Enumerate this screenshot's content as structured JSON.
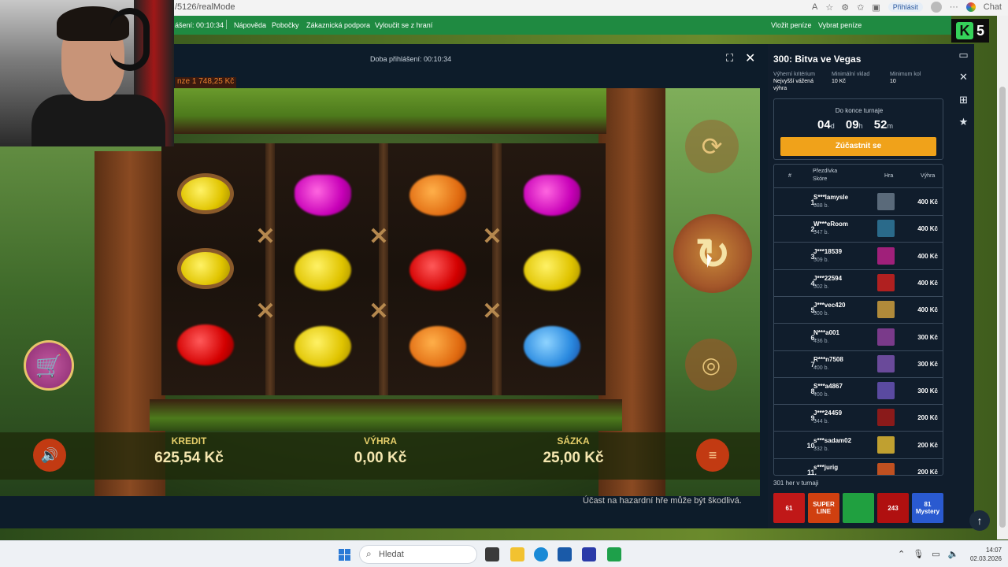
{
  "browser": {
    "url": "/5126/realMode",
    "login_label": "Přihlásit",
    "chat_label": "Chat",
    "more_label": "···"
  },
  "site_nav": {
    "session": "ášení: 00:10:34",
    "items": [
      "Nápověda",
      "Pobočky",
      "Zákaznická podpora",
      "Vyloučit se z hraní"
    ],
    "deposit": "Vložit peníze",
    "withdraw": "Vybrat peníze"
  },
  "brand": {
    "k": "K",
    "five": "5"
  },
  "game_header": {
    "login_time": "Doba přihlášení: 00:10:34",
    "fullscreen_icon": "fullscreen-icon",
    "close_icon": "close-icon"
  },
  "balance_strip": "nze 1 748,25 Kč",
  "game": {
    "kredit_label": "KREDIT",
    "kredit_value": "625,54 Kč",
    "vyhra_label": "VÝHRA",
    "vyhra_value": "0,00 Kč",
    "sazka_label": "SÁZKA",
    "sazka_value": "25,00 Kč",
    "warning": "Účast na hazardní hře může být škodlivá.",
    "reels": [
      [
        "lemon-sharp",
        "lemon-sharp",
        "cherry"
      ],
      [
        "plum",
        "lemon",
        "lemon"
      ],
      [
        "orange",
        "cherry",
        "orange"
      ],
      [
        "plum",
        "lemon",
        "blue"
      ]
    ]
  },
  "tournament": {
    "title": "300: Bitva ve Vegas",
    "criteria_label": "Výherní kritérium",
    "criteria_value": "Nejvyšší vážená výhra",
    "min_deposit_label": "Minimální vklad",
    "min_deposit_value": "10 Kč",
    "min_rounds_label": "Minimum kol",
    "min_rounds_value": "10",
    "countdown_label": "Do konce turnaje",
    "days": "04",
    "days_unit": "d",
    "hours": "09",
    "hours_unit": "h",
    "minutes": "52",
    "minutes_unit": "m",
    "join_label": "Zúčastnit se",
    "col_rank": "#",
    "col_nick": "Přezdívka",
    "col_score": "Skóre",
    "col_game": "Hra",
    "col_prize": "Výhra",
    "rows": [
      {
        "rank": "1.",
        "name": "S***lamysle",
        "score": "688 b.",
        "prize": "400 Kč",
        "color": "#5a6a7a"
      },
      {
        "rank": "2.",
        "name": "W***eRoom",
        "score": "547 b.",
        "prize": "400 Kč",
        "color": "#2a6a8a"
      },
      {
        "rank": "3.",
        "name": "J***18539",
        "score": "509 b.",
        "prize": "400 Kč",
        "color": "#a0207a"
      },
      {
        "rank": "4.",
        "name": "J***22594",
        "score": "502 b.",
        "prize": "400 Kč",
        "color": "#b02020"
      },
      {
        "rank": "5.",
        "name": "J***vec420",
        "score": "500 b.",
        "prize": "400 Kč",
        "color": "#b08a3a"
      },
      {
        "rank": "6.",
        "name": "N***a001",
        "score": "436 b.",
        "prize": "300 Kč",
        "color": "#7a3a8a"
      },
      {
        "rank": "7.",
        "name": "R***n7508",
        "score": "400 b.",
        "prize": "300 Kč",
        "color": "#6a4a9a"
      },
      {
        "rank": "8.",
        "name": "S***a4867",
        "score": "400 b.",
        "prize": "300 Kč",
        "color": "#5a4aa0"
      },
      {
        "rank": "9.",
        "name": "J***24459",
        "score": "344 b.",
        "prize": "200 Kč",
        "color": "#8a1a1a"
      },
      {
        "rank": "10.",
        "name": "s***sadam02",
        "score": "332 b.",
        "prize": "200 Kč",
        "color": "#c0a030"
      },
      {
        "rank": "11.",
        "name": "s***jurig",
        "score": "",
        "prize": "200 Kč",
        "color": "#c05020"
      }
    ],
    "games_count": "301 her v turnaji",
    "games": [
      {
        "label": "61",
        "color": "#c01818"
      },
      {
        "label": "SUPER LINE",
        "color": "#d04010"
      },
      {
        "label": "",
        "color": "#20a040"
      },
      {
        "label": "243",
        "color": "#b01010"
      },
      {
        "label": "81 Mystery",
        "color": "#2a5ad0"
      }
    ]
  },
  "taskbar": {
    "search_placeholder": "Hledat",
    "time": "14:07",
    "date": "02.03.2026"
  }
}
